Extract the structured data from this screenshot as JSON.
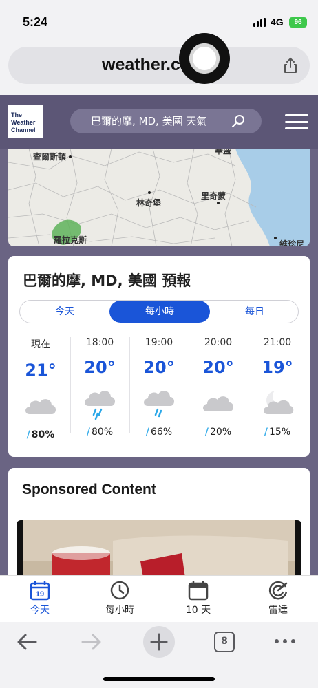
{
  "status": {
    "time": "5:24",
    "network": "4G",
    "battery": "96"
  },
  "browser": {
    "url_text": "weather.c"
  },
  "site": {
    "logo_line1": "The",
    "logo_line2": "Weather",
    "logo_line3": "Channel",
    "location_search": "巴爾的摩, MD, 美國 天氣"
  },
  "map": {
    "labels": [
      "查爾斯頓",
      "林奇堡",
      "里奇蒙",
      "羅拉克斯",
      "維珍尼",
      "華盛"
    ]
  },
  "forecast": {
    "title": "巴爾的摩, MD, 美國 預報",
    "tabs": [
      "今天",
      "每小時",
      "每日"
    ],
    "active_tab": "每小時",
    "hours": [
      {
        "time": "現在",
        "temp": "21°",
        "icon": "cloudy-icon",
        "precip": "80%"
      },
      {
        "time": "18:00",
        "temp": "20°",
        "icon": "rain-icon",
        "precip": "80%"
      },
      {
        "time": "19:00",
        "temp": "20°",
        "icon": "rain-icon",
        "precip": "66%"
      },
      {
        "time": "20:00",
        "temp": "20°",
        "icon": "cloudy-icon",
        "precip": "20%"
      },
      {
        "time": "21:00",
        "temp": "19°",
        "icon": "partly-cloudy-night-icon",
        "precip": "15%"
      }
    ]
  },
  "sponsored": {
    "title": "Sponsored Content"
  },
  "bottom_nav": [
    {
      "label": "今天",
      "icon": "calendar-day-icon",
      "badge": "19"
    },
    {
      "label": "每小時",
      "icon": "clock-icon"
    },
    {
      "label": "10 天",
      "icon": "calendar-icon"
    },
    {
      "label": "雷達",
      "icon": "radar-icon"
    }
  ],
  "toolbar": {
    "tab_count": "8"
  },
  "colors": {
    "accent": "#1a55d8",
    "header_bg": "#5c5676",
    "page_bg": "#6a6483"
  }
}
